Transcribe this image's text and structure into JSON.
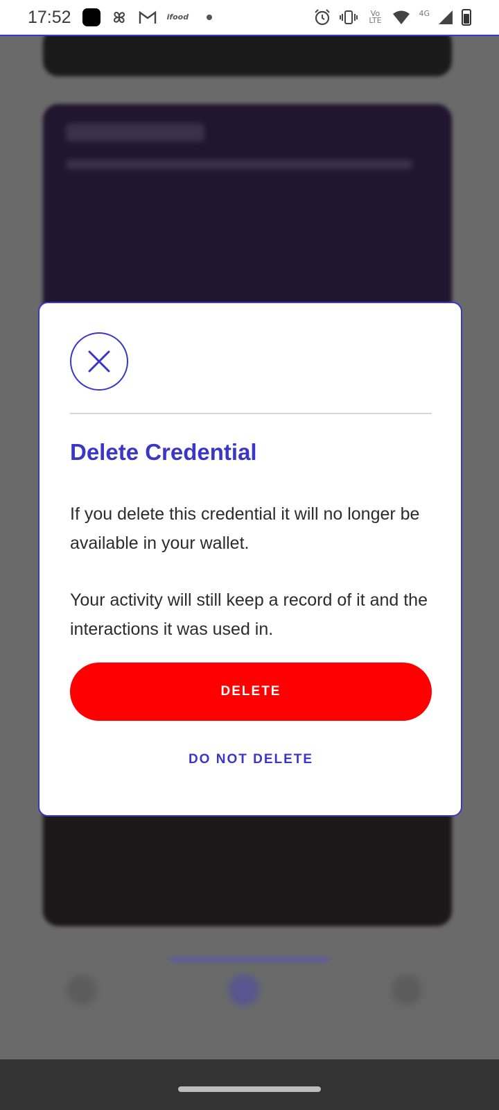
{
  "status_bar": {
    "time": "17:52",
    "left_icons": [
      "app-square-icon",
      "pinwheel-icon",
      "gmail-icon",
      "ifood-icon",
      "notification-dot-icon"
    ],
    "right_icons": [
      "alarm-icon",
      "vibrate-icon",
      "volte-icon",
      "wifi-icon",
      "cell-signal-icon",
      "battery-icon"
    ],
    "volte_label": "Vo LTE",
    "network_label": "4G",
    "ifood_label": "ifood"
  },
  "dialog": {
    "icon": "close-icon",
    "title": "Delete Credential",
    "paragraph_1": "If you delete this credential it will no longer be available in your wallet.",
    "paragraph_2": "Your activity will still keep a record of it and the interactions it was used in.",
    "delete_label": "DELETE",
    "cancel_label": "DO NOT DELETE"
  },
  "colors": {
    "accent": "#3a36c9",
    "danger": "#ff0000",
    "overlay": "#6a6a6a"
  }
}
